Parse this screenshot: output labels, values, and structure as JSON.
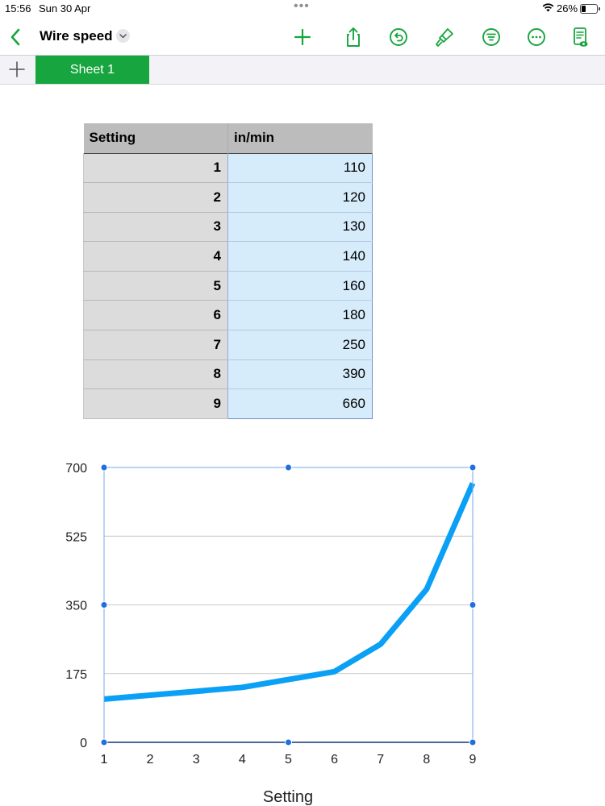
{
  "status": {
    "time": "15:56",
    "date": "Sun 30 Apr",
    "battery": "26%",
    "battery_level": 0.26
  },
  "toolbar": {
    "title": "Wire speed",
    "icons": [
      "add-icon",
      "share-icon",
      "undo-icon",
      "format-brush-icon",
      "filter-icon",
      "more-icon",
      "reader-view-icon"
    ]
  },
  "sheets": {
    "tabs": [
      {
        "label": "Sheet 1",
        "active": true
      }
    ]
  },
  "table": {
    "headers": [
      "Setting",
      "in/min"
    ],
    "rows": [
      [
        "1",
        "110"
      ],
      [
        "2",
        "120"
      ],
      [
        "3",
        "130"
      ],
      [
        "4",
        "140"
      ],
      [
        "5",
        "160"
      ],
      [
        "6",
        "180"
      ],
      [
        "7",
        "250"
      ],
      [
        "8",
        "390"
      ],
      [
        "9",
        "660"
      ]
    ]
  },
  "chart_data": {
    "type": "line",
    "x": [
      1,
      2,
      3,
      4,
      5,
      6,
      7,
      8,
      9
    ],
    "series": [
      {
        "values": [
          110,
          120,
          130,
          140,
          160,
          180,
          250,
          390,
          660
        ],
        "color": "#0aa0f5"
      }
    ],
    "xlabel": "Setting",
    "ylabel": "",
    "ylim": [
      0,
      700
    ],
    "xlim": [
      1,
      9
    ],
    "yticks": [
      0,
      175,
      350,
      525,
      700
    ],
    "xticks": [
      1,
      2,
      3,
      4,
      5,
      6,
      7,
      8,
      9
    ],
    "grid": true,
    "selected": true
  },
  "colors": {
    "accent": "#17a53f",
    "line": "#0aa0f5",
    "selection": "#1f6fe0"
  }
}
